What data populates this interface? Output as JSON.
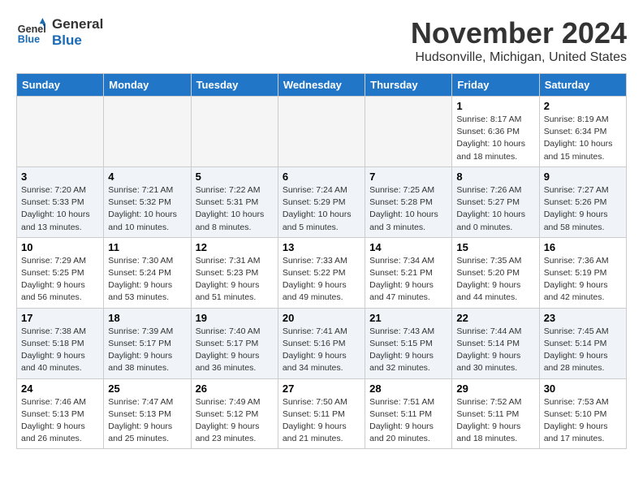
{
  "logo": {
    "line1": "General",
    "line2": "Blue"
  },
  "title": "November 2024",
  "location": "Hudsonville, Michigan, United States",
  "days_of_week": [
    "Sunday",
    "Monday",
    "Tuesday",
    "Wednesday",
    "Thursday",
    "Friday",
    "Saturday"
  ],
  "weeks": [
    [
      {
        "day": "",
        "info": ""
      },
      {
        "day": "",
        "info": ""
      },
      {
        "day": "",
        "info": ""
      },
      {
        "day": "",
        "info": ""
      },
      {
        "day": "",
        "info": ""
      },
      {
        "day": "1",
        "info": "Sunrise: 8:17 AM\nSunset: 6:36 PM\nDaylight: 10 hours and 18 minutes."
      },
      {
        "day": "2",
        "info": "Sunrise: 8:19 AM\nSunset: 6:34 PM\nDaylight: 10 hours and 15 minutes."
      }
    ],
    [
      {
        "day": "3",
        "info": "Sunrise: 7:20 AM\nSunset: 5:33 PM\nDaylight: 10 hours and 13 minutes."
      },
      {
        "day": "4",
        "info": "Sunrise: 7:21 AM\nSunset: 5:32 PM\nDaylight: 10 hours and 10 minutes."
      },
      {
        "day": "5",
        "info": "Sunrise: 7:22 AM\nSunset: 5:31 PM\nDaylight: 10 hours and 8 minutes."
      },
      {
        "day": "6",
        "info": "Sunrise: 7:24 AM\nSunset: 5:29 PM\nDaylight: 10 hours and 5 minutes."
      },
      {
        "day": "7",
        "info": "Sunrise: 7:25 AM\nSunset: 5:28 PM\nDaylight: 10 hours and 3 minutes."
      },
      {
        "day": "8",
        "info": "Sunrise: 7:26 AM\nSunset: 5:27 PM\nDaylight: 10 hours and 0 minutes."
      },
      {
        "day": "9",
        "info": "Sunrise: 7:27 AM\nSunset: 5:26 PM\nDaylight: 9 hours and 58 minutes."
      }
    ],
    [
      {
        "day": "10",
        "info": "Sunrise: 7:29 AM\nSunset: 5:25 PM\nDaylight: 9 hours and 56 minutes."
      },
      {
        "day": "11",
        "info": "Sunrise: 7:30 AM\nSunset: 5:24 PM\nDaylight: 9 hours and 53 minutes."
      },
      {
        "day": "12",
        "info": "Sunrise: 7:31 AM\nSunset: 5:23 PM\nDaylight: 9 hours and 51 minutes."
      },
      {
        "day": "13",
        "info": "Sunrise: 7:33 AM\nSunset: 5:22 PM\nDaylight: 9 hours and 49 minutes."
      },
      {
        "day": "14",
        "info": "Sunrise: 7:34 AM\nSunset: 5:21 PM\nDaylight: 9 hours and 47 minutes."
      },
      {
        "day": "15",
        "info": "Sunrise: 7:35 AM\nSunset: 5:20 PM\nDaylight: 9 hours and 44 minutes."
      },
      {
        "day": "16",
        "info": "Sunrise: 7:36 AM\nSunset: 5:19 PM\nDaylight: 9 hours and 42 minutes."
      }
    ],
    [
      {
        "day": "17",
        "info": "Sunrise: 7:38 AM\nSunset: 5:18 PM\nDaylight: 9 hours and 40 minutes."
      },
      {
        "day": "18",
        "info": "Sunrise: 7:39 AM\nSunset: 5:17 PM\nDaylight: 9 hours and 38 minutes."
      },
      {
        "day": "19",
        "info": "Sunrise: 7:40 AM\nSunset: 5:17 PM\nDaylight: 9 hours and 36 minutes."
      },
      {
        "day": "20",
        "info": "Sunrise: 7:41 AM\nSunset: 5:16 PM\nDaylight: 9 hours and 34 minutes."
      },
      {
        "day": "21",
        "info": "Sunrise: 7:43 AM\nSunset: 5:15 PM\nDaylight: 9 hours and 32 minutes."
      },
      {
        "day": "22",
        "info": "Sunrise: 7:44 AM\nSunset: 5:14 PM\nDaylight: 9 hours and 30 minutes."
      },
      {
        "day": "23",
        "info": "Sunrise: 7:45 AM\nSunset: 5:14 PM\nDaylight: 9 hours and 28 minutes."
      }
    ],
    [
      {
        "day": "24",
        "info": "Sunrise: 7:46 AM\nSunset: 5:13 PM\nDaylight: 9 hours and 26 minutes."
      },
      {
        "day": "25",
        "info": "Sunrise: 7:47 AM\nSunset: 5:13 PM\nDaylight: 9 hours and 25 minutes."
      },
      {
        "day": "26",
        "info": "Sunrise: 7:49 AM\nSunset: 5:12 PM\nDaylight: 9 hours and 23 minutes."
      },
      {
        "day": "27",
        "info": "Sunrise: 7:50 AM\nSunset: 5:11 PM\nDaylight: 9 hours and 21 minutes."
      },
      {
        "day": "28",
        "info": "Sunrise: 7:51 AM\nSunset: 5:11 PM\nDaylight: 9 hours and 20 minutes."
      },
      {
        "day": "29",
        "info": "Sunrise: 7:52 AM\nSunset: 5:11 PM\nDaylight: 9 hours and 18 minutes."
      },
      {
        "day": "30",
        "info": "Sunrise: 7:53 AM\nSunset: 5:10 PM\nDaylight: 9 hours and 17 minutes."
      }
    ]
  ]
}
